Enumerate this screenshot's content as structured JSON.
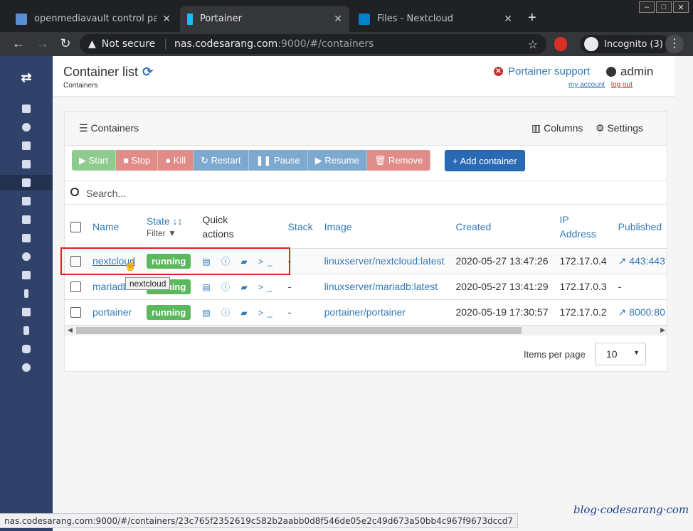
{
  "browser": {
    "tabs": [
      {
        "label": "openmediavault control panel - c",
        "close": "✕"
      },
      {
        "label": "Portainer",
        "close": "✕"
      },
      {
        "label": "Files - Nextcloud",
        "close": "✕"
      }
    ],
    "new_tab": "+",
    "window_controls": [
      "–",
      "□",
      "✕"
    ],
    "not_secure": "Not secure",
    "url_host": "nas.codesarang.com",
    "url_path": ":9000/#/containers",
    "incognito": "Incognito (3)"
  },
  "sidebar": {
    "brand_icon": "swap-icon",
    "items": [
      "home-icon",
      "dashboard-icon",
      "rocket-icon",
      "list-icon",
      "containers-icon",
      "images-icon",
      "network-icon",
      "volumes-icon",
      "events-icon",
      "engine-icon",
      "bolt-icon",
      "users-icon",
      "endpoints-icon",
      "registries-icon",
      "settings-icon"
    ]
  },
  "header": {
    "title": "Container list",
    "breadcrumb": "Containers",
    "support": "Portainer support",
    "user": "admin",
    "my_account": "my account",
    "log_out": "log out"
  },
  "panel": {
    "title": "Containers",
    "columns": "Columns",
    "settings": "Settings",
    "buttons": {
      "start": "▶ Start",
      "stop": "■ Stop",
      "kill": "● Kill",
      "restart": "↻ Restart",
      "pause": "❚❚ Pause",
      "resume": "▶ Resume",
      "remove": "🗑 Remove",
      "add": "+ Add container"
    },
    "search_placeholder": "Search...",
    "table": {
      "headers": {
        "name": "Name",
        "state": "State ↓↕",
        "filter": "Filter",
        "quick": "Quick",
        "actions": "actions",
        "stack": "Stack",
        "image": "Image",
        "created": "Created",
        "ip": "IP",
        "address": "Address",
        "published": "Published"
      },
      "rows": [
        {
          "name": "nextcloud",
          "state": "running",
          "quick": "▤ ⓘ ▰ >_",
          "stack": "-",
          "image": "linuxserver/nextcloud:latest",
          "created": "2020-05-27 13:47:26",
          "ip": "172.17.0.4",
          "published": "↗ 443:443"
        },
        {
          "name": "mariadb",
          "state": "running",
          "quick": "▤ ⓘ ▰ >_",
          "stack": "-",
          "image": "linuxserver/mariadb:latest",
          "created": "2020-05-27 13:41:29",
          "ip": "172.17.0.3",
          "published": "-"
        },
        {
          "name": "portainer",
          "state": "running",
          "quick": "▤ ⓘ ▰ >_",
          "stack": "-",
          "image": "portainer/portainer",
          "created": "2020-05-19 17:30:57",
          "ip": "172.17.0.2",
          "published": "↗ 8000:80"
        }
      ]
    },
    "items_per_page_label": "Items per page",
    "items_per_page_value": "10"
  },
  "tooltip": "nextcloud",
  "status_url": "nas.codesarang.com:9000/#/containers/23c765f2352619c582b2aabb0d8f546de05e2c49d673a50bb4c967f9673dccd7",
  "watermark": "blog·codesarang·com"
}
